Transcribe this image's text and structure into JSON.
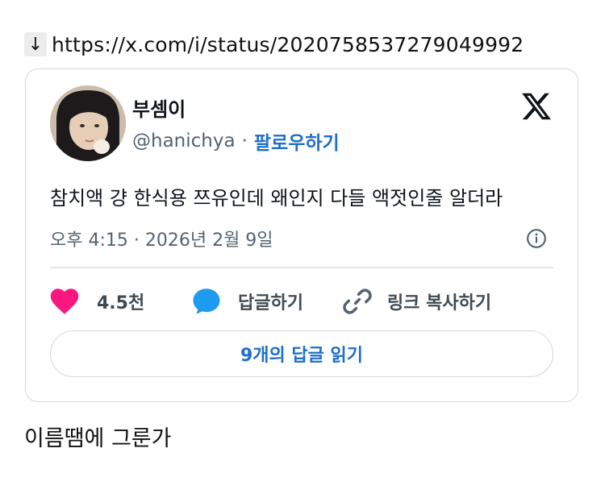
{
  "link": {
    "arrow": "↓",
    "url": "https://x.com/i/status/2020758537279049992"
  },
  "tweet": {
    "display_name": "부셈이",
    "handle": "@hanichya",
    "separator": "·",
    "follow_label": "팔로우하기",
    "text": "참치액 걍 한식용 쯔유인데 왜인지 다들 액젓인줄 알더라",
    "meta": "오후 4:15 · 2026년 2월 9일",
    "likes": "4.5천",
    "reply_label": "답글하기",
    "copy_link_label": "링크 복사하기",
    "read_replies_label": "9개의 답글 읽기"
  },
  "caption": "이름땜에 그룬가",
  "colors": {
    "like": "#f91880",
    "reply": "#1d9bf0",
    "link_blue": "#1d6fc9",
    "border": "#cfd9de"
  },
  "icons": {
    "logo": "x-logo-icon",
    "info": "info-icon",
    "like": "heart-icon",
    "reply": "speech-bubble-icon",
    "copy": "link-chain-icon"
  }
}
